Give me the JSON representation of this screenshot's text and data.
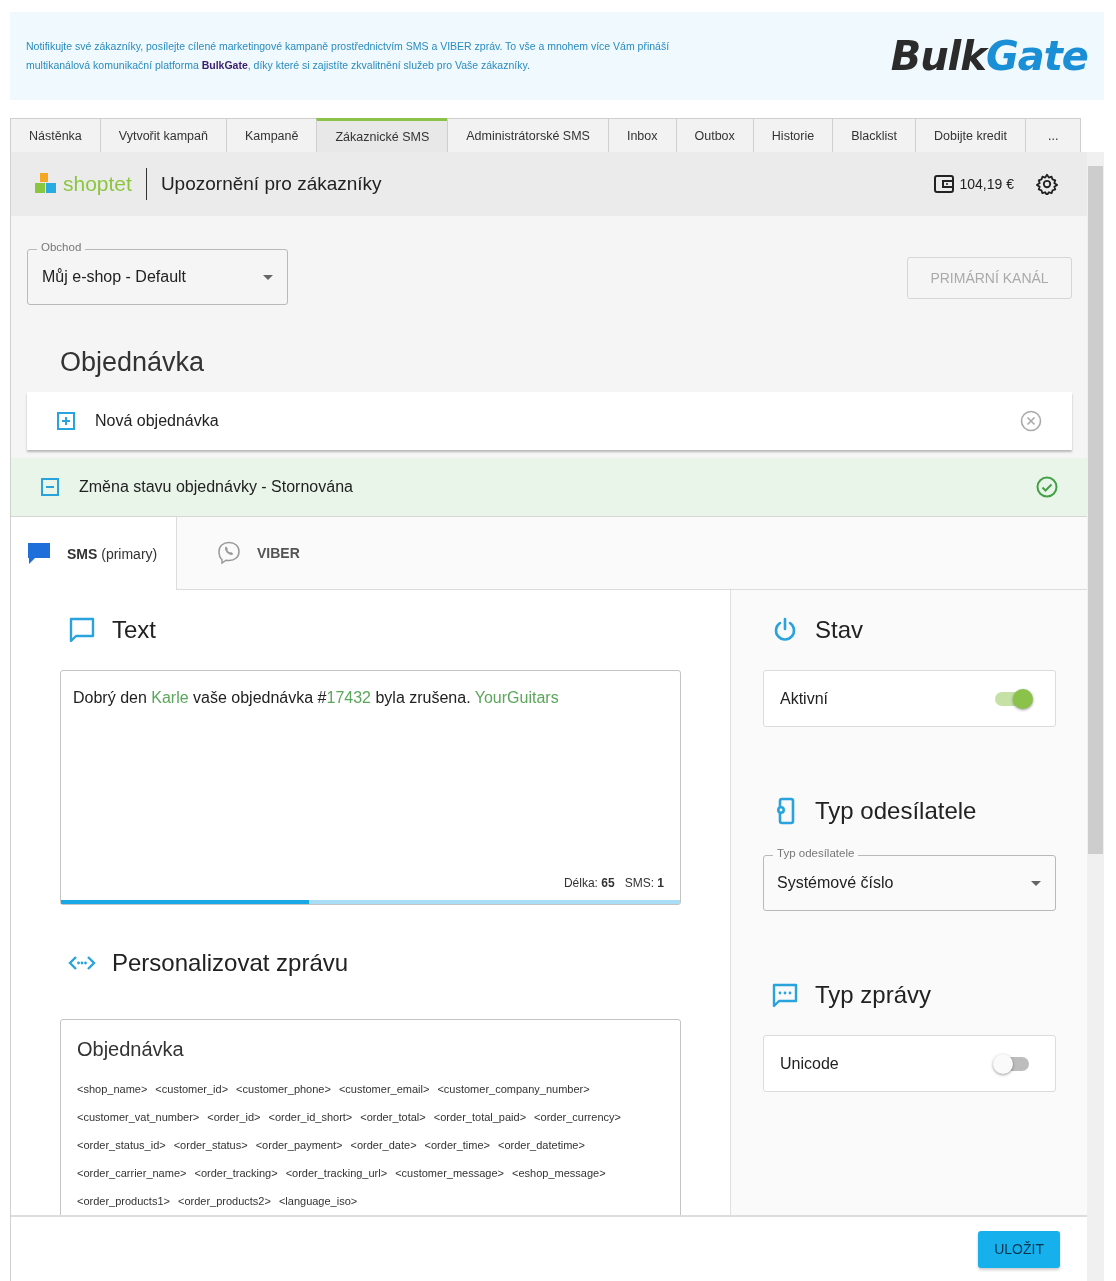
{
  "banner": {
    "text": "Notifikujte své zákazníky, posílejte cílené marketingové kampaně prostřednictvím SMS a VIBER zpráv. To vše a mnohem více Vám přináší multikanálová komunikační platforma **BulkGate**, díky které si zajistíte zkvalitnění služeb pro Vaše zákazníky.",
    "logo": [
      {
        "text": "Bulk",
        "color": "#2b2b2b"
      },
      {
        "text": "Gate",
        "color": "#1a8fd6"
      }
    ]
  },
  "tabs": [
    {
      "label": "Nástěnka",
      "selected": false
    },
    {
      "label": "Vytvořit kampaň",
      "selected": false
    },
    {
      "label": "Kampaně",
      "selected": false
    },
    {
      "label": "Zákaznické SMS",
      "selected": true
    },
    {
      "label": "Administrátorské SMS",
      "selected": false
    },
    {
      "label": "Inbox",
      "selected": false
    },
    {
      "label": "Outbox",
      "selected": false
    },
    {
      "label": "Historie",
      "selected": false
    },
    {
      "label": "Blacklist",
      "selected": false
    },
    {
      "label": "Dobijte kredit",
      "selected": false
    },
    {
      "label": "...",
      "selected": false
    }
  ],
  "header": {
    "brand": "shoptet",
    "title": "Upozornění pro zákazníky",
    "credit": "104,19 €"
  },
  "shop_select": {
    "label": "Obchod",
    "value": "Můj e-shop - Default"
  },
  "primary_channel_button": {
    "label": "PRIMÁRNÍ KANÁL",
    "disabled": true
  },
  "section_title": "Objednávka",
  "events": [
    {
      "label": "Nová objednávka",
      "expanded": false,
      "active": false
    },
    {
      "label": "Změna stavu objednávky - Stornována",
      "expanded": true,
      "active": true
    }
  ],
  "channel_tabs": [
    {
      "kind": "sms",
      "label": "SMS",
      "note": "(primary)",
      "selected": true
    },
    {
      "kind": "viber",
      "label": "VIBER",
      "selected": false
    }
  ],
  "text_section": {
    "title": "Text",
    "message": [
      {
        "kind": "text",
        "text": "Dobrý den "
      },
      {
        "kind": "variable",
        "text": "Karle"
      },
      {
        "kind": "text",
        "text": " vaše objednávka #"
      },
      {
        "kind": "variable",
        "text": "17432"
      },
      {
        "kind": "text",
        "text": " byla zrušena. "
      },
      {
        "kind": "variable",
        "text": "YourGuitars"
      }
    ],
    "length_label": "Délka:",
    "length": "65",
    "sms_label": "SMS:",
    "sms_count": "1",
    "level": 0.4
  },
  "personalize": {
    "title": "Personalizovat zprávu",
    "group_title": "Objednávka",
    "variables": [
      "<shop_name>",
      "<customer_id>",
      "<customer_phone>",
      "<customer_email>",
      "<customer_company_number>",
      "<customer_vat_number>",
      "<order_id>",
      "<order_id_short>",
      "<order_total>",
      "<order_total_paid>",
      "<order_currency>",
      "<order_status_id>",
      "<order_status>",
      "<order_payment>",
      "<order_date>",
      "<order_time>",
      "<order_datetime>",
      "<order_carrier_name>",
      "<order_tracking>",
      "<order_tracking_url>",
      "<customer_message>",
      "<eshop_message>",
      "<order_products1>",
      "<order_products2>",
      "<language_iso>"
    ]
  },
  "state": {
    "title": "Stav",
    "label": "Aktivní",
    "on": true
  },
  "sender": {
    "title": "Typ odesílatele",
    "label": "Typ odesílatele",
    "value": "Systémové číslo"
  },
  "message_type": {
    "title": "Typ zprávy",
    "label": "Unicode",
    "on": false
  },
  "save_button": "ULOŽIT"
}
